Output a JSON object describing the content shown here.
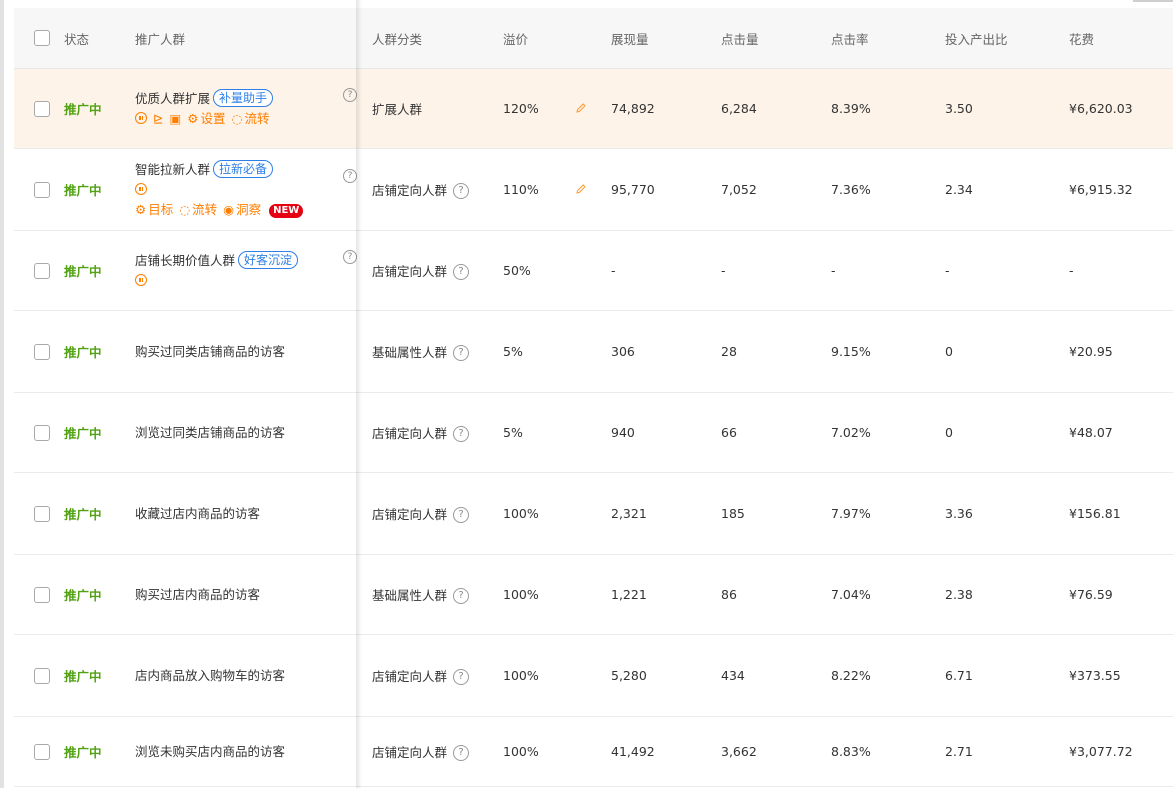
{
  "columns": {
    "status": "状态",
    "crowd": "推广人群",
    "category": "人群分类",
    "premium": "溢价",
    "impressions": "展现量",
    "clicks": "点击量",
    "ctr": "点击率",
    "roi": "投入产出比",
    "cost": "花费"
  },
  "icons": {
    "help": "?",
    "pause": "pause-circle-icon",
    "chart": "⊵",
    "report": "▣",
    "settings": "⚙",
    "flow": "◌",
    "target": "⚙",
    "insight": "◉",
    "edit": "pencil-icon"
  },
  "colors": {
    "status_active": "#52a213",
    "action_orange": "#ff7e00",
    "badge_blue": "#2f7fe6",
    "new_red": "#e60012",
    "highlight_row": "#fdf3e8"
  },
  "rows": [
    {
      "status": "推广中",
      "name": "优质人群扩展",
      "badge": "补量助手",
      "actions": {
        "settings": "设置",
        "flow": "流转"
      },
      "category": "扩展人群",
      "premium": "120%",
      "impressions": "74,892",
      "clicks": "6,284",
      "ctr": "8.39%",
      "roi": "3.50",
      "cost": "¥6,620.03"
    },
    {
      "status": "推广中",
      "name": "智能拉新人群",
      "badge": "拉新必备",
      "actions": {
        "target": "目标",
        "flow": "流转",
        "insight": "洞察",
        "new": "NEW"
      },
      "category": "店铺定向人群",
      "premium": "110%",
      "impressions": "95,770",
      "clicks": "7,052",
      "ctr": "7.36%",
      "roi": "2.34",
      "cost": "¥6,915.32"
    },
    {
      "status": "推广中",
      "name": "店铺长期价值人群",
      "badge": "好客沉淀",
      "category": "店铺定向人群",
      "premium": "50%",
      "impressions": "-",
      "clicks": "-",
      "ctr": "-",
      "roi": "-",
      "cost": "-"
    },
    {
      "status": "推广中",
      "name": "购买过同类店铺商品的访客",
      "category": "基础属性人群",
      "premium": "5%",
      "impressions": "306",
      "clicks": "28",
      "ctr": "9.15%",
      "roi": "0",
      "cost": "¥20.95"
    },
    {
      "status": "推广中",
      "name": "浏览过同类店铺商品的访客",
      "category": "店铺定向人群",
      "premium": "5%",
      "impressions": "940",
      "clicks": "66",
      "ctr": "7.02%",
      "roi": "0",
      "cost": "¥48.07"
    },
    {
      "status": "推广中",
      "name": "收藏过店内商品的访客",
      "category": "店铺定向人群",
      "premium": "100%",
      "impressions": "2,321",
      "clicks": "185",
      "ctr": "7.97%",
      "roi": "3.36",
      "cost": "¥156.81"
    },
    {
      "status": "推广中",
      "name": "购买过店内商品的访客",
      "category": "基础属性人群",
      "premium": "100%",
      "impressions": "1,221",
      "clicks": "86",
      "ctr": "7.04%",
      "roi": "2.38",
      "cost": "¥76.59"
    },
    {
      "status": "推广中",
      "name": "店内商品放入购物车的访客",
      "category": "店铺定向人群",
      "premium": "100%",
      "impressions": "5,280",
      "clicks": "434",
      "ctr": "8.22%",
      "roi": "6.71",
      "cost": "¥373.55"
    },
    {
      "status": "推广中",
      "name": "浏览未购买店内商品的访客",
      "category": "店铺定向人群",
      "premium": "100%",
      "impressions": "41,492",
      "clicks": "3,662",
      "ctr": "8.83%",
      "roi": "2.71",
      "cost": "¥3,077.72"
    }
  ]
}
